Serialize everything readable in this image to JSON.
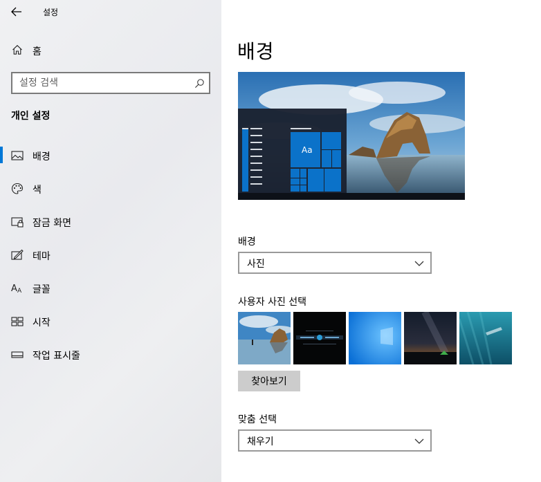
{
  "window": {
    "title": "설정"
  },
  "sidebar": {
    "home_label": "홈",
    "search_placeholder": "설정 검색",
    "section_title": "개인 설정",
    "items": [
      {
        "label": "배경",
        "icon": "picture-icon",
        "active": true
      },
      {
        "label": "색",
        "icon": "palette-icon",
        "active": false
      },
      {
        "label": "잠금 화면",
        "icon": "lock-screen-icon",
        "active": false
      },
      {
        "label": "테마",
        "icon": "theme-icon",
        "active": false
      },
      {
        "label": "글꼴",
        "icon": "font-icon",
        "active": false
      },
      {
        "label": "시작",
        "icon": "start-icon",
        "active": false
      },
      {
        "label": "작업 표시줄",
        "icon": "taskbar-icon",
        "active": false
      }
    ]
  },
  "main": {
    "title": "배경",
    "preview": {
      "tile_text": "Aa"
    },
    "background": {
      "label": "배경",
      "value": "사진"
    },
    "choose_picture": {
      "label": "사용자 사진 선택",
      "thumbnails": [
        "beach-arch-thumbnail",
        "dark-logo-thumbnail",
        "windows-blue-thumbnail",
        "night-sky-thumbnail",
        "underwater-thumbnail"
      ]
    },
    "browse_label": "찾아보기",
    "fit": {
      "label": "맞춤 선택",
      "value": "채우기"
    }
  },
  "colors": {
    "accent": "#0078d7",
    "sidebar_bg": "#eceef0",
    "button_bg": "#cccccc"
  }
}
